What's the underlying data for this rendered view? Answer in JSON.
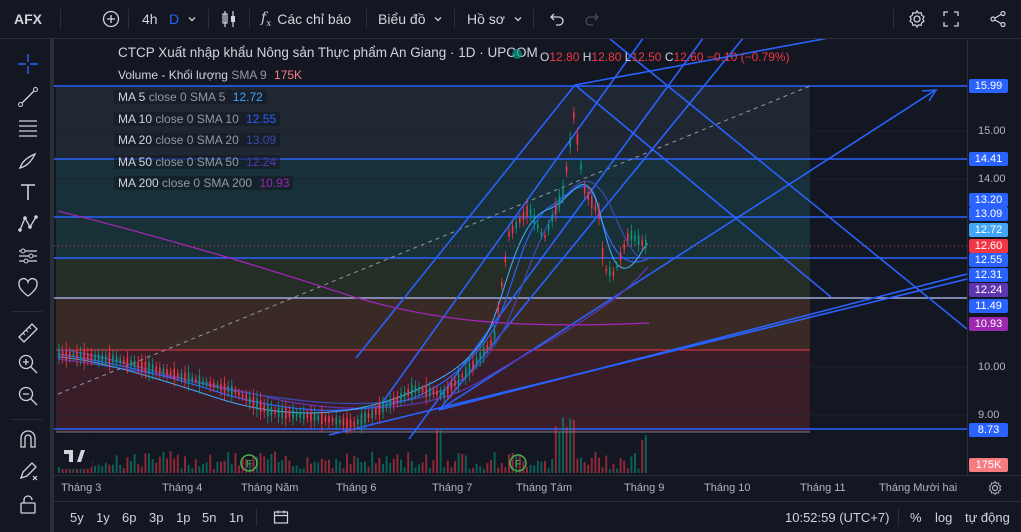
{
  "header": {
    "symbol": "AFX",
    "interval": "4h",
    "interval_badge": "D",
    "indicators_label": "Các chỉ báo",
    "chart_type_label": "Biểu đồ",
    "profile_label": "Hồ sơ"
  },
  "legend": {
    "title": "CTCP Xuất nhập khẩu Nông sản Thực phẩm An Giang · 1D · UPCOM",
    "ohlc": {
      "o_label": "O",
      "o": "12.80",
      "h_label": "H",
      "h": "12.80",
      "l_label": "L",
      "l": "12.50",
      "c_label": "C",
      "c": "12.60",
      "change": "−0.10 (−0.79%)"
    },
    "volume": {
      "label": "Volume - Khối lượng",
      "sub": "SMA 9",
      "value": "175K"
    },
    "ma": [
      {
        "label": "MA 5",
        "sub": "close 0 SMA 5",
        "value": "12.72",
        "color": "#42a5f5"
      },
      {
        "label": "MA 10",
        "sub": "close 0 SMA 10",
        "value": "12.55",
        "color": "#2962ff"
      },
      {
        "label": "MA 20",
        "sub": "close 0 SMA 20",
        "value": "13.09",
        "color": "#3949ab"
      },
      {
        "label": "MA 50",
        "sub": "close 0 SMA 50",
        "value": "12.24",
        "color": "#5e35b1"
      },
      {
        "label": "MA 200",
        "sub": "close 0 SMA 200",
        "value": "10.93",
        "color": "#9c27b0"
      }
    ]
  },
  "price_axis": {
    "ticks": [
      "15.00",
      "14.00",
      "10.00",
      "9.00"
    ],
    "labels": [
      {
        "value": "15.99",
        "color": "#2962ff"
      },
      {
        "value": "14.41",
        "color": "#2962ff"
      },
      {
        "value": "13.20",
        "color": "#2962ff"
      },
      {
        "value": "13.09",
        "color": "#2962ff"
      },
      {
        "value": "12.72",
        "color": "#42a5f5"
      },
      {
        "value": "12.60",
        "color": "#f23645"
      },
      {
        "value": "12.55",
        "color": "#2962ff"
      },
      {
        "value": "12.31",
        "color": "#2962ff"
      },
      {
        "value": "12.24",
        "color": "#5e35b1"
      },
      {
        "value": "11.49",
        "color": "#2962ff"
      },
      {
        "value": "10.93",
        "color": "#9c27b0"
      },
      {
        "value": "8.73",
        "color": "#2962ff"
      },
      {
        "value": "175K",
        "color": "#f77c80"
      }
    ]
  },
  "time_axis": [
    "Tháng 3",
    "Tháng 4",
    "Tháng Năm",
    "Tháng 6",
    "Tháng 7",
    "Tháng Tám",
    "Tháng 9",
    "Tháng 10",
    "Tháng 11",
    "Tháng Mười hai"
  ],
  "ranges": [
    "5y",
    "1y",
    "6p",
    "3p",
    "1p",
    "5n",
    "1n"
  ],
  "status": {
    "time": "10:52:59 (UTC+7)",
    "percent": "%",
    "log": "log",
    "auto": "tự động"
  },
  "colors": {
    "up": "#089981",
    "down": "#f23645",
    "drawing": "#2962ff",
    "background": "#131722"
  }
}
